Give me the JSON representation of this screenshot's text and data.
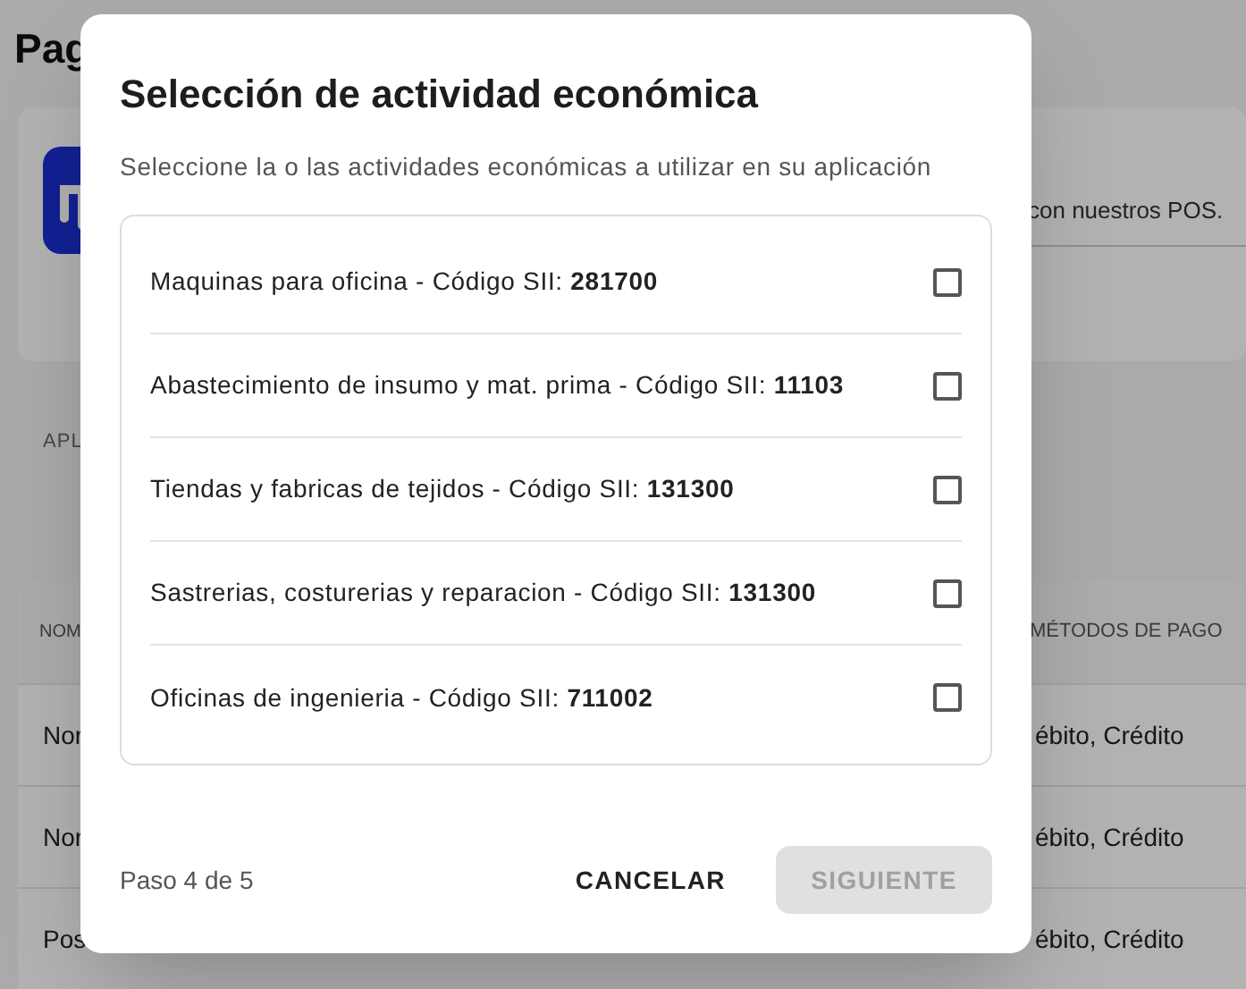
{
  "page": {
    "title": "Pag",
    "card_text": "con nuestros POS.",
    "section_label": "APL",
    "table": {
      "columns": [
        "NOM",
        "MÉTODOS DE PAGO"
      ],
      "rows": [
        [
          "Nor",
          "ébito, Crédito"
        ],
        [
          "Nor",
          "ébito, Crédito"
        ],
        [
          "Pos",
          "ébito, Crédito"
        ]
      ]
    }
  },
  "dialog": {
    "title": "Selección de actividad económica",
    "subtitle": "Seleccione la o las actividades económicas a utilizar en su aplicación",
    "items": [
      {
        "label": "Maquinas para oficina - Código SII: **281700**",
        "checked": false
      },
      {
        "label": "Abastecimiento de insumo y mat. prima - Código SII: **11103**",
        "checked": false
      },
      {
        "label": "Tiendas y fabricas de tejidos - Código SII: **131300**",
        "checked": false
      },
      {
        "label": "Sastrerias, costurerias y reparacion - Código SII: **131300**",
        "checked": false
      },
      {
        "label": "Oficinas de ingenieria - Código SII: **711002**",
        "checked": false
      }
    ],
    "step": "Paso 4 de 5",
    "buttons": [
      {
        "label": "CANCELAR",
        "disabled": false
      },
      {
        "label": "SIGUIENTE",
        "disabled": true
      }
    ]
  }
}
